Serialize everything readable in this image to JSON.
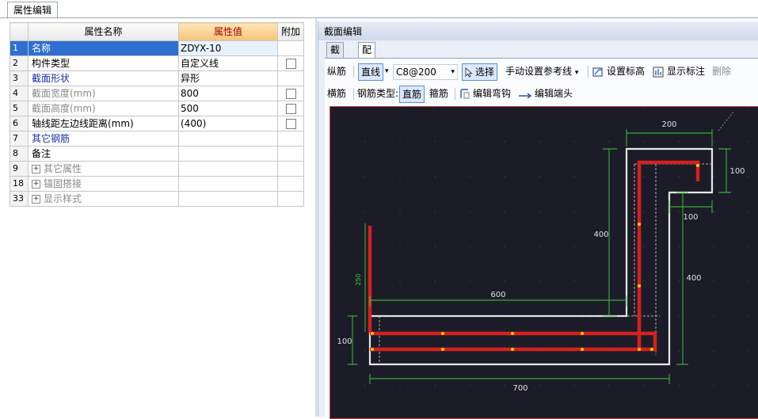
{
  "window": {
    "tab_label": "属性编辑"
  },
  "props": {
    "headers": {
      "name": "属性名称",
      "value": "属性值",
      "extra": "附加"
    },
    "rows": [
      {
        "num": "1",
        "name": "名称",
        "value": "ZDYX-10",
        "checkbox": false,
        "style": "blue"
      },
      {
        "num": "2",
        "name": "构件类型",
        "value": "自定义线",
        "checkbox": true,
        "style": "dark"
      },
      {
        "num": "3",
        "name": "截面形状",
        "value": "异形",
        "checkbox": false,
        "style": "blue"
      },
      {
        "num": "4",
        "name": "截面宽度(mm)",
        "value": "800",
        "checkbox": true,
        "style": "gray"
      },
      {
        "num": "5",
        "name": "截面高度(mm)",
        "value": "500",
        "checkbox": true,
        "style": "gray"
      },
      {
        "num": "6",
        "name": "轴线距左边线距离(mm)",
        "value": "(400)",
        "checkbox": true,
        "style": "dark"
      },
      {
        "num": "7",
        "name": "其它钢筋",
        "value": "",
        "checkbox": false,
        "style": "blue"
      },
      {
        "num": "8",
        "name": "备注",
        "value": "",
        "checkbox": false,
        "style": "dark"
      },
      {
        "num": "9",
        "name": "其它属性",
        "value": "",
        "checkbox": false,
        "style": "gray",
        "expandable": true
      },
      {
        "num": "18",
        "name": "锚固搭接",
        "value": "",
        "checkbox": false,
        "style": "gray",
        "expandable": true
      },
      {
        "num": "33",
        "name": "显示样式",
        "value": "",
        "checkbox": false,
        "style": "gray",
        "expandable": true
      }
    ]
  },
  "editor": {
    "title": "截面编辑",
    "tabs": [
      "截面",
      "配筋"
    ],
    "active_tab": "配筋",
    "toolbar1": {
      "longitudinal": "纵筋",
      "line_mode": "直线",
      "spec": "C8@200",
      "select": "选择",
      "manual_ref": "手动设置参考线",
      "set_elevation": "设置标高",
      "show_dims": "显示标注",
      "delete": "删除"
    },
    "toolbar2": {
      "transverse": "横筋",
      "rebar_type_label": "钢筋类型:",
      "straight": "直筋",
      "stirrup": "箍筋",
      "edit_bend": "编辑弯钩",
      "edit_end": "编辑端头"
    },
    "dims": {
      "top_width": "200",
      "right_hook": "100",
      "step_width": "100",
      "vertical_left": "400",
      "vertical_right": "400",
      "span_600": "600",
      "left_height": "100",
      "bottom_700": "700",
      "rebar_250": "250"
    },
    "colors": {
      "canvas_bg": "#1c1c28",
      "rebar": "#d42020",
      "outline": "#e8e8e8",
      "dimension": "#3ccf3c",
      "point": "#ffd200"
    }
  }
}
